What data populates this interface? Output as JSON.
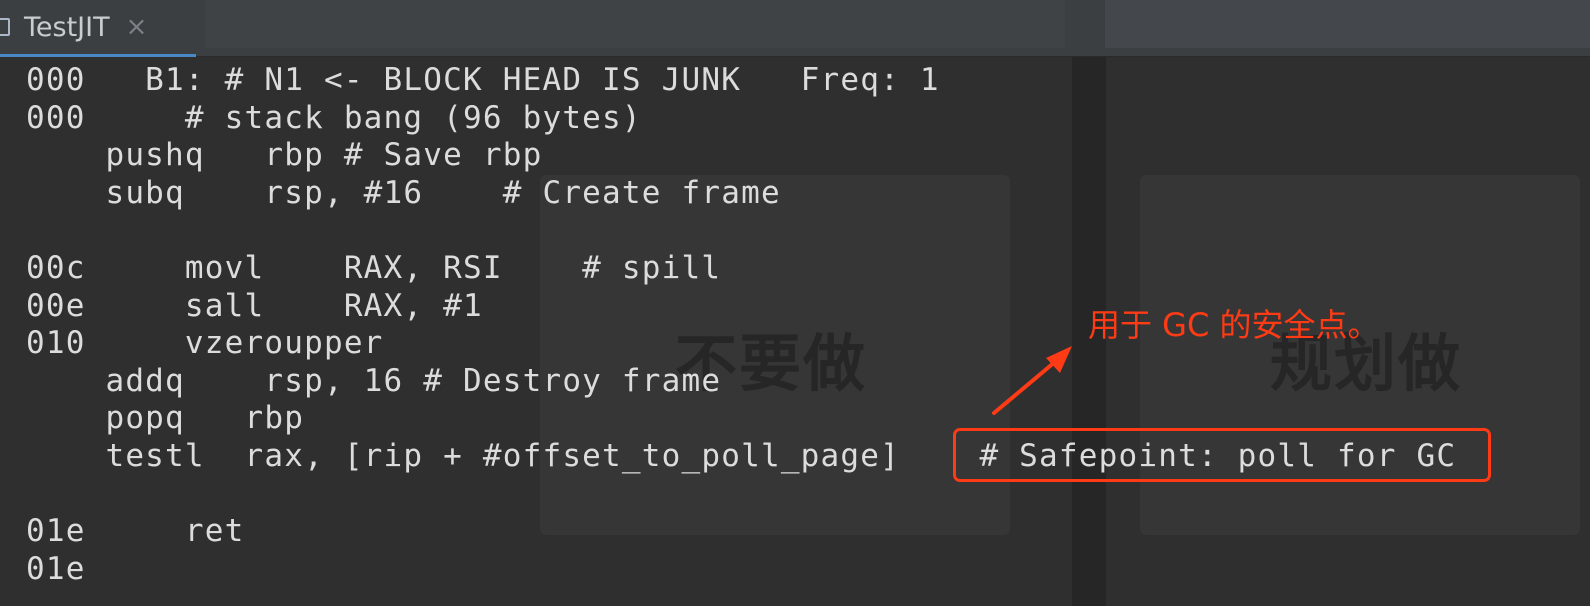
{
  "tab": {
    "title": "TestJIT",
    "close_glyph": "×",
    "icon": "file-icon"
  },
  "background": {
    "panel_left_text": "不要做",
    "panel_right_text": "规划做"
  },
  "code_lines": [
    "000   B1: # N1 <- BLOCK HEAD IS JUNK   Freq: 1",
    "000     # stack bang (96 bytes)",
    "    pushq   rbp # Save rbp",
    "    subq    rsp, #16    # Create frame",
    "",
    "00c     movl    RAX, RSI    # spill",
    "00e     sall    RAX, #1",
    "010     vzeroupper",
    "    addq    rsp, 16 # Destroy frame",
    "    popq   rbp",
    "    testl  rax, [rip + #offset_to_poll_page]    # Safepoint: poll for GC",
    "",
    "01e     ret",
    "01e"
  ],
  "annotation": {
    "text": "用于 GC 的安全点。",
    "color": "#ff3b16"
  },
  "colors": {
    "editor_bg": "#2f2f2f",
    "code_text": "#dcdcdc",
    "tab_accent": "#4a88c7"
  }
}
